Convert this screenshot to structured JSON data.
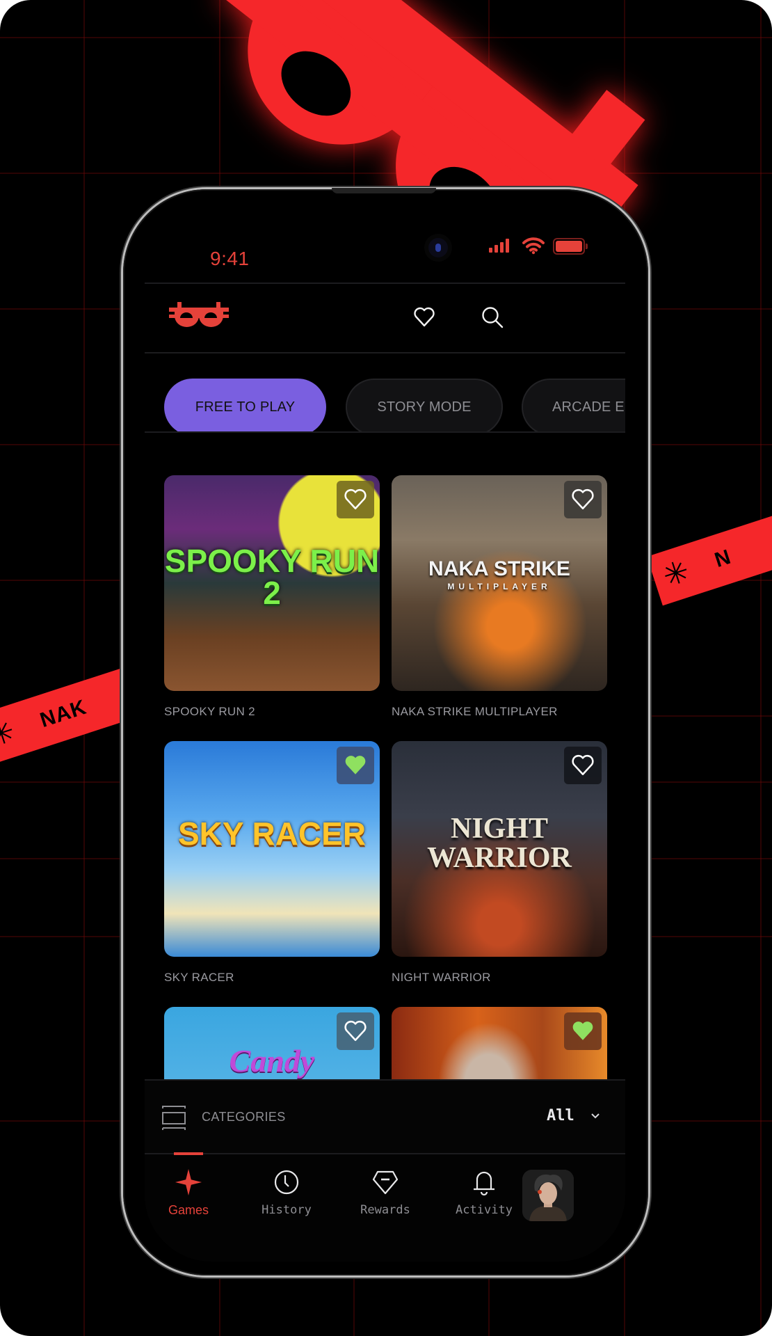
{
  "colors": {
    "accent_red": "#e5423a",
    "brand_red": "#f5272a",
    "chip_active": "#7a5fe0",
    "favorite_green": "#8fe060",
    "background": "#000000"
  },
  "background": {
    "ribbon_text": "NAK",
    "ribbon_right_text": "N",
    "ribbon_symbol": "✳"
  },
  "status_bar": {
    "time": "9:41",
    "icons": [
      "signal-icon",
      "wifi-icon",
      "battery-icon"
    ]
  },
  "header": {
    "logo": "brand-logo",
    "actions": [
      {
        "name": "favorites-button",
        "icon": "heart-icon"
      },
      {
        "name": "search-button",
        "icon": "search-icon"
      }
    ]
  },
  "filters": {
    "chips": [
      {
        "label": "FREE TO PLAY",
        "active": true
      },
      {
        "label": "STORY MODE",
        "active": false
      },
      {
        "label": "ARCADE E",
        "active": false
      }
    ]
  },
  "games": [
    {
      "title": "SPOOKY RUN 2",
      "art_title": "SPOOKY RUN 2",
      "favorited": false
    },
    {
      "title": "NAKA STRIKE MULTIPLAYER",
      "art_title": "NAKA STRIKE",
      "art_subtitle": "MULTIPLAYER",
      "favorited": false
    },
    {
      "title": "SKY RACER",
      "art_title": "SKY RACER",
      "favorited": true
    },
    {
      "title": "NIGHT WARRIOR",
      "art_title": "NIGHT WARRIOR",
      "favorited": false
    },
    {
      "title": "",
      "art_title": "Candy",
      "favorited": false
    },
    {
      "title": "",
      "art_title": "",
      "favorited": true
    }
  ],
  "categories": {
    "label": "CATEGORIES",
    "selected": "All"
  },
  "tab_bar": {
    "items": [
      {
        "label": "Games",
        "icon": "sparkle-icon",
        "active": true
      },
      {
        "label": "History",
        "icon": "clock-icon",
        "active": false
      },
      {
        "label": "Rewards",
        "icon": "diamond-icon",
        "active": false
      },
      {
        "label": "Activity",
        "icon": "bell-icon",
        "active": false
      }
    ],
    "profile": "profile-avatar"
  }
}
